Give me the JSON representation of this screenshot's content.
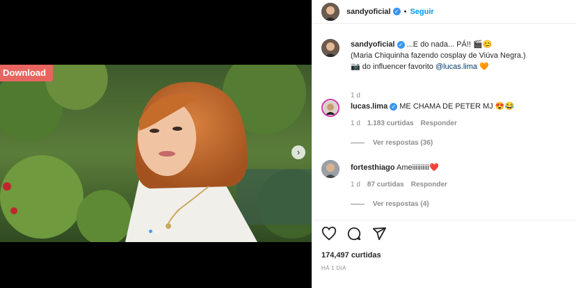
{
  "media": {
    "download_label": "Download",
    "next_icon": "chevron-right-icon",
    "carousel_slides": 2,
    "active_slide": 1
  },
  "header": {
    "username": "sandyoficial",
    "separator": "•",
    "follow_label": "Seguir"
  },
  "caption": {
    "username": "sandyoficial",
    "line1": "...E do nada... PÁ!! 🎬😊",
    "line2": "(Maria Chiquinha fazendo cosplay de Viúva Negra.)",
    "line3_prefix": "📷 do influencer favorito ",
    "mention": "@lucas.lima",
    "line3_suffix": " 🧡",
    "age": "1 d"
  },
  "comments": [
    {
      "username": "lucas.lima",
      "text": "ME CHAMA DE PETER MJ 😍😂",
      "age": "1 d",
      "likes": "1.183 curtidas",
      "reply_label": "Responder",
      "view_replies": "Ver respostas (36)"
    },
    {
      "username": "fortesthiago",
      "text": "Ameiiiiiiiiii❤️",
      "age": "1 d",
      "likes": "87 curtidas",
      "reply_label": "Responder",
      "view_replies": "Ver respostas (4)"
    }
  ],
  "footer": {
    "likes": "174,497 curtidas",
    "time": "HÁ 1 DIA",
    "icons": [
      "heart-icon",
      "comment-icon",
      "share-icon"
    ]
  },
  "colors": {
    "accent": "#0095f6",
    "download_bg": "#e8655f",
    "verified": "#3897f0"
  }
}
